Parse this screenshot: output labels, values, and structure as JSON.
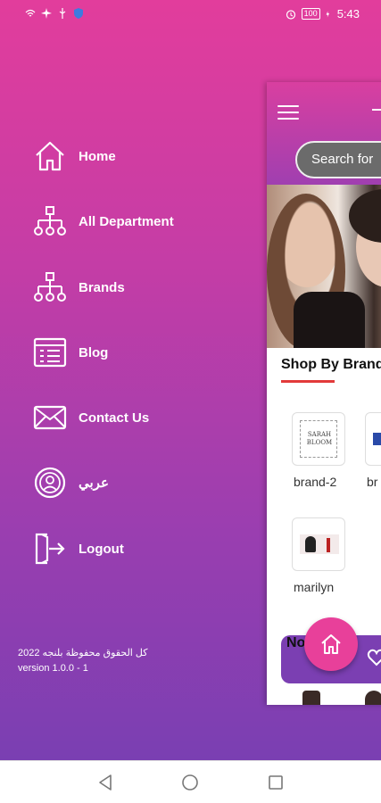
{
  "status_bar": {
    "time": "5:43",
    "battery": "100",
    "icons": [
      "wifi-icon",
      "airplane-icon",
      "usb-icon",
      "shield-icon",
      "alarm-icon",
      "charging-icon"
    ]
  },
  "drawer": {
    "items": [
      {
        "label": "Home",
        "icon": "home-icon"
      },
      {
        "label": "All Department",
        "icon": "hierarchy-icon"
      },
      {
        "label": "Brands",
        "icon": "hierarchy-icon"
      },
      {
        "label": "Blog",
        "icon": "blog-icon"
      },
      {
        "label": "Contact Us",
        "icon": "mail-icon"
      },
      {
        "label": "عربي",
        "icon": "language-icon"
      },
      {
        "label": "Logout",
        "icon": "logout-icon"
      }
    ],
    "copyright": "كل الحقوق محفوظة بلنجه 2022",
    "version": "version 1.0.0 - 1"
  },
  "app": {
    "search_placeholder": "Search for",
    "section_title": "Shop By Brands",
    "brands": [
      {
        "name": "brand-2",
        "logo_text": "SARAH BLOOM"
      },
      {
        "name": "br"
      },
      {
        "name": "marilyn"
      }
    ],
    "second_section": "Nou"
  },
  "colors": {
    "gradient_top": "#e23d9c",
    "gradient_bottom": "#7a3fb2",
    "accent": "#e8409a",
    "underline": "#e23a3a"
  }
}
